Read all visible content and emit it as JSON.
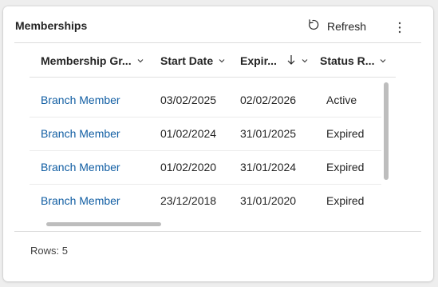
{
  "panel": {
    "title": "Memberships",
    "refresh_label": "Refresh",
    "refresh_icon": "refresh-icon",
    "more_icon": "more-vertical-icon"
  },
  "columns": [
    {
      "label": "Membership Gr...",
      "icon": "chevron-down-icon"
    },
    {
      "label": "Start Date",
      "icon": "chevron-down-icon"
    },
    {
      "label": "Expir...",
      "icon": "sort-descending-arrow-icon"
    },
    {
      "label": "Status R...",
      "icon": "chevron-down-icon"
    }
  ],
  "rows": [
    {
      "group": "Branch Member",
      "start": "03/02/2025",
      "expiry": "02/02/2026",
      "status": "Active"
    },
    {
      "group": "Branch Member",
      "start": "01/02/2024",
      "expiry": "31/01/2025",
      "status": "Expired"
    },
    {
      "group": "Branch Member",
      "start": "01/02/2020",
      "expiry": "31/01/2024",
      "status": "Expired"
    },
    {
      "group": "Branch Member",
      "start": "23/12/2018",
      "expiry": "31/01/2020",
      "status": "Expired"
    }
  ],
  "footer": {
    "rows_text": "Rows: 5"
  },
  "colors": {
    "link": "#115ea3",
    "text": "#242424"
  }
}
